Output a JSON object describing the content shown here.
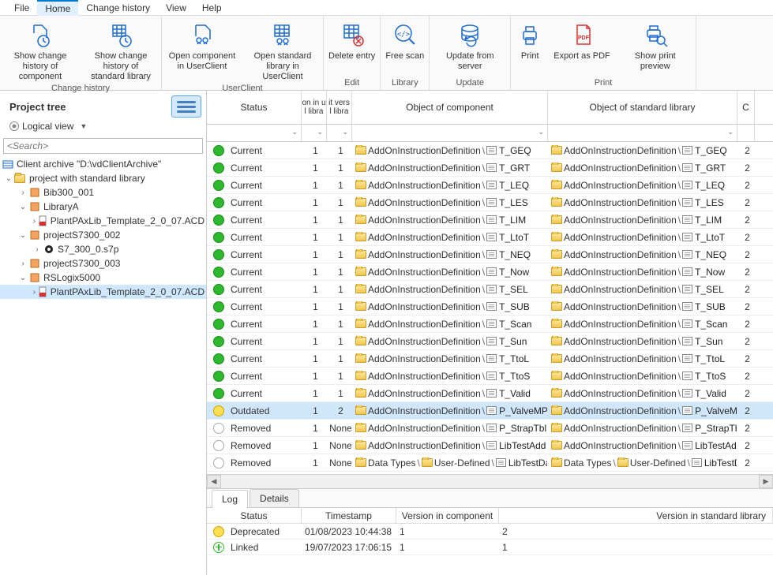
{
  "menu": {
    "file": "File",
    "home": "Home",
    "change": "Change history",
    "view": "View",
    "help": "Help"
  },
  "ribbon": {
    "groups": {
      "change_history": "Change history",
      "userclient": "UserClient",
      "edit": "Edit",
      "library": "Library",
      "update": "Update",
      "print": "Print"
    },
    "btn": {
      "comp_history": "Show change history of component",
      "lib_history": "Show change history of standard library",
      "open_comp": "Open component in UserClient",
      "open_lib": "Open standard library in UserClient",
      "delete": "Delete entry",
      "freescan": "Free scan",
      "update": "Update from server",
      "print": "Print",
      "pdf": "Export as PDF",
      "preview": "Show print preview"
    }
  },
  "sidebar": {
    "title": "Project tree",
    "logical": "Logical view",
    "search_ph": "<Search>",
    "archive": "Client archive \"D:\\vdClientArchive\"",
    "project": "project with standard library",
    "bib": "Bib300_001",
    "libA": "LibraryA",
    "tmpl1": "PlantPAxLib_Template_2_0_07.ACD",
    "ps002": "projectS7300_002",
    "s7": "S7_300_0.s7p",
    "ps003": "projectS7300_003",
    "rslogix": "RSLogix5000",
    "tmpl2": "PlantPAxLib_Template_2_0_07.ACD"
  },
  "grid": {
    "hdr": {
      "status": "Status",
      "v1a": "on in u",
      "v1b": "l libra",
      "v2a": "it vers",
      "v2b": "l libra",
      "obj1": "Object of component",
      "obj2": "Object of standard library",
      "last": "C"
    },
    "aoid": "AddOnInstructionDefinition",
    "dt": "Data Types",
    "ud": "User-Defined",
    "rows": [
      {
        "s": "Current",
        "st": "current",
        "v1": "1",
        "v2": "1",
        "o1": "T_GEQ",
        "o2": "T_GEQ",
        "n": "2"
      },
      {
        "s": "Current",
        "st": "current",
        "v1": "1",
        "v2": "1",
        "o1": "T_GRT",
        "o2": "T_GRT",
        "n": "2"
      },
      {
        "s": "Current",
        "st": "current",
        "v1": "1",
        "v2": "1",
        "o1": "T_LEQ",
        "o2": "T_LEQ",
        "n": "2"
      },
      {
        "s": "Current",
        "st": "current",
        "v1": "1",
        "v2": "1",
        "o1": "T_LES",
        "o2": "T_LES",
        "n": "2"
      },
      {
        "s": "Current",
        "st": "current",
        "v1": "1",
        "v2": "1",
        "o1": "T_LIM",
        "o2": "T_LIM",
        "n": "2"
      },
      {
        "s": "Current",
        "st": "current",
        "v1": "1",
        "v2": "1",
        "o1": "T_LtoT",
        "o2": "T_LtoT",
        "n": "2"
      },
      {
        "s": "Current",
        "st": "current",
        "v1": "1",
        "v2": "1",
        "o1": "T_NEQ",
        "o2": "T_NEQ",
        "n": "2"
      },
      {
        "s": "Current",
        "st": "current",
        "v1": "1",
        "v2": "1",
        "o1": "T_Now",
        "o2": "T_Now",
        "n": "2"
      },
      {
        "s": "Current",
        "st": "current",
        "v1": "1",
        "v2": "1",
        "o1": "T_SEL",
        "o2": "T_SEL",
        "n": "2"
      },
      {
        "s": "Current",
        "st": "current",
        "v1": "1",
        "v2": "1",
        "o1": "T_SUB",
        "o2": "T_SUB",
        "n": "2"
      },
      {
        "s": "Current",
        "st": "current",
        "v1": "1",
        "v2": "1",
        "o1": "T_Scan",
        "o2": "T_Scan",
        "n": "2"
      },
      {
        "s": "Current",
        "st": "current",
        "v1": "1",
        "v2": "1",
        "o1": "T_Sun",
        "o2": "T_Sun",
        "n": "2"
      },
      {
        "s": "Current",
        "st": "current",
        "v1": "1",
        "v2": "1",
        "o1": "T_TtoL",
        "o2": "T_TtoL",
        "n": "2"
      },
      {
        "s": "Current",
        "st": "current",
        "v1": "1",
        "v2": "1",
        "o1": "T_TtoS",
        "o2": "T_TtoS",
        "n": "2"
      },
      {
        "s": "Current",
        "st": "current",
        "v1": "1",
        "v2": "1",
        "o1": "T_Valid",
        "o2": "T_Valid",
        "n": "2"
      },
      {
        "s": "Outdated",
        "st": "outdated",
        "v1": "1",
        "v2": "2",
        "o1": "P_ValveMP",
        "o2": "P_ValveMP",
        "n": "2",
        "sel": true
      },
      {
        "s": "Removed",
        "st": "removed",
        "v1": "1",
        "v2": "None",
        "o1": "P_StrapTbl",
        "o2": "P_StrapTbl",
        "n": "2"
      },
      {
        "s": "Removed",
        "st": "removed",
        "v1": "1",
        "v2": "None",
        "o1": "LibTestAdd",
        "o2": "LibTestAdd",
        "n": "2"
      },
      {
        "s": "Removed",
        "st": "removed",
        "v1": "1",
        "v2": "None",
        "o1": "LibTestDat",
        "o2": "LibTestDat",
        "n": "2",
        "dt": true
      }
    ]
  },
  "bottom": {
    "tabs": {
      "log": "Log",
      "details": "Details"
    },
    "hdr": {
      "status": "Status",
      "ts": "Timestamp",
      "vc": "Version in component",
      "vs": "Version in standard library"
    },
    "rows": [
      {
        "s": "Deprecated",
        "st": "deprecated",
        "ts": "01/08/2023 10:44:38",
        "vc": "1",
        "vs": "2"
      },
      {
        "s": "Linked",
        "st": "linked",
        "ts": "19/07/2023 17:06:15",
        "vc": "1",
        "vs": "1"
      }
    ]
  }
}
